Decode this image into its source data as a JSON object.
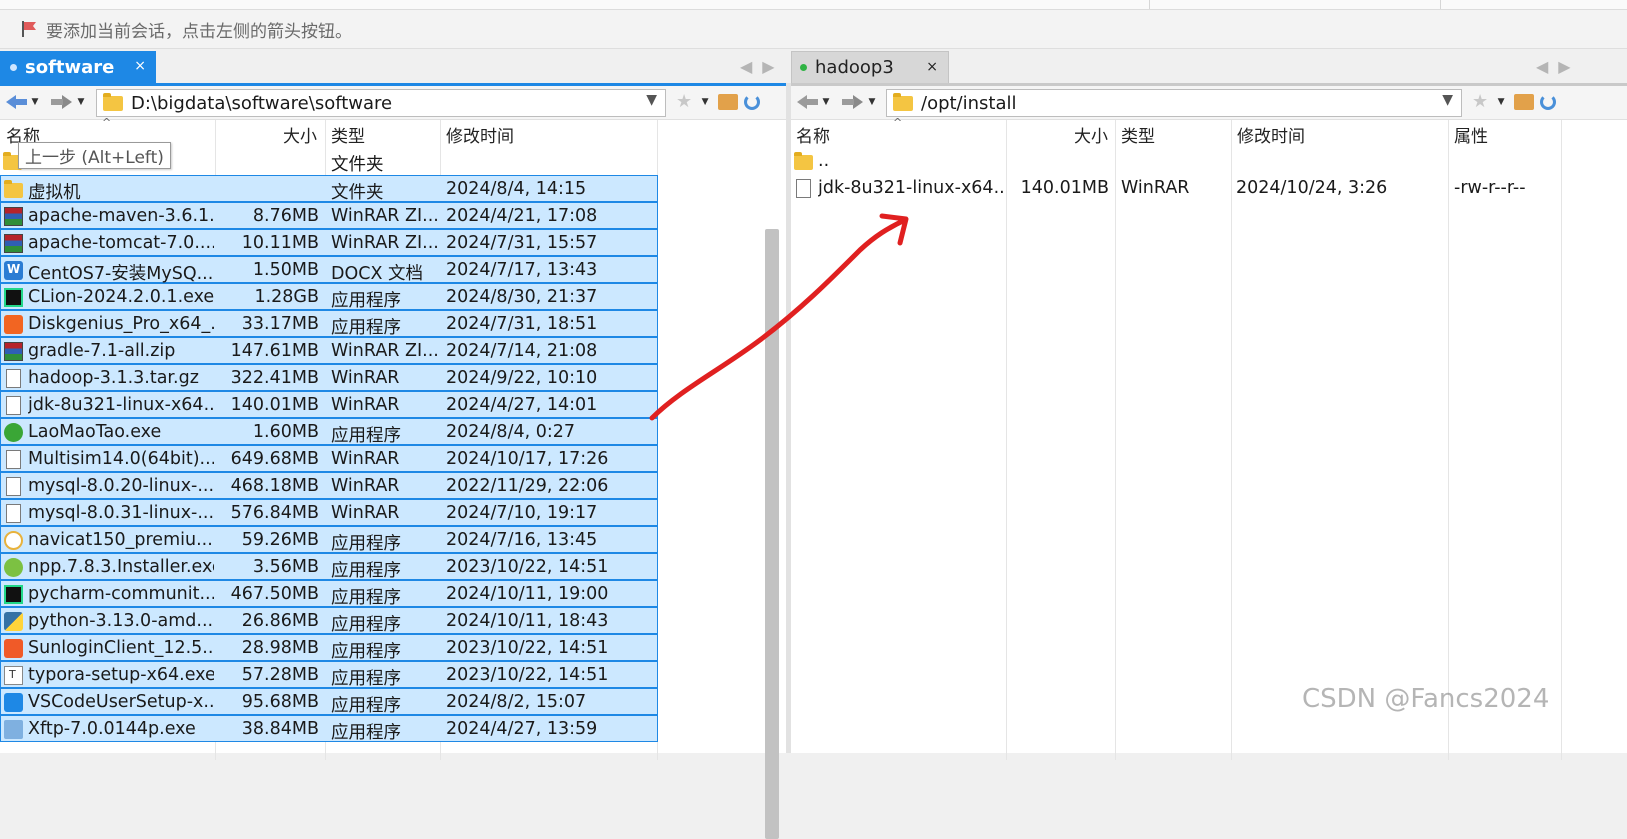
{
  "hint": {
    "text": "要添加当前会话，点击左侧的箭头按钮。"
  },
  "left": {
    "tab": {
      "label": "software",
      "close": "×"
    },
    "path": "D:\\bigdata\\software\\software",
    "columns": {
      "name": "名称",
      "size": "大小",
      "type": "类型",
      "modified": "修改时间"
    },
    "tooltip": "上一步 (Alt+Left)",
    "parent_row": {
      "type": "文件夹"
    },
    "rows": [
      {
        "name": "虚拟机",
        "size": "",
        "type": "文件夹",
        "modified": "2024/8/4, 14:15",
        "icon": "folder"
      },
      {
        "name": "apache-maven-3.6.1...",
        "size": "8.76MB",
        "type": "WinRAR ZI...",
        "modified": "2024/4/21, 17:08",
        "icon": "rar"
      },
      {
        "name": "apache-tomcat-7.0....",
        "size": "10.11MB",
        "type": "WinRAR ZI...",
        "modified": "2024/7/31, 15:57",
        "icon": "rar"
      },
      {
        "name": "CentOS7-安装MySQ...",
        "size": "1.50MB",
        "type": "DOCX 文档",
        "modified": "2024/7/17, 13:43",
        "icon": "word"
      },
      {
        "name": "CLion-2024.2.0.1.exe",
        "size": "1.28GB",
        "type": "应用程序",
        "modified": "2024/8/30, 21:37",
        "icon": "clion"
      },
      {
        "name": "Diskgenius_Pro_x64_...",
        "size": "33.17MB",
        "type": "应用程序",
        "modified": "2024/7/31, 18:51",
        "icon": "dg"
      },
      {
        "name": "gradle-7.1-all.zip",
        "size": "147.61MB",
        "type": "WinRAR ZI...",
        "modified": "2024/7/14, 21:08",
        "icon": "rar"
      },
      {
        "name": "hadoop-3.1.3.tar.gz",
        "size": "322.41MB",
        "type": "WinRAR",
        "modified": "2024/9/22, 10:10",
        "icon": "file"
      },
      {
        "name": "jdk-8u321-linux-x64...",
        "size": "140.01MB",
        "type": "WinRAR",
        "modified": "2024/4/27, 14:01",
        "icon": "file"
      },
      {
        "name": "LaoMaoTao.exe",
        "size": "1.60MB",
        "type": "应用程序",
        "modified": "2024/8/4, 0:27",
        "icon": "lmt"
      },
      {
        "name": "Multisim14.0(64bit)....",
        "size": "649.68MB",
        "type": "WinRAR",
        "modified": "2024/10/17, 17:26",
        "icon": "file"
      },
      {
        "name": "mysql-8.0.20-linux-...",
        "size": "468.18MB",
        "type": "WinRAR",
        "modified": "2022/11/29, 22:06",
        "icon": "file"
      },
      {
        "name": "mysql-8.0.31-linux-...",
        "size": "576.84MB",
        "type": "WinRAR",
        "modified": "2024/7/10, 19:17",
        "icon": "file"
      },
      {
        "name": "navicat150_premiu...",
        "size": "59.26MB",
        "type": "应用程序",
        "modified": "2024/7/16, 13:45",
        "icon": "navicat"
      },
      {
        "name": "npp.7.8.3.Installer.exe",
        "size": "3.56MB",
        "type": "应用程序",
        "modified": "2023/10/22, 14:51",
        "icon": "npp"
      },
      {
        "name": "pycharm-communit...",
        "size": "467.50MB",
        "type": "应用程序",
        "modified": "2024/10/11, 19:00",
        "icon": "pyc"
      },
      {
        "name": "python-3.13.0-amd...",
        "size": "26.86MB",
        "type": "应用程序",
        "modified": "2024/10/11, 18:43",
        "icon": "py"
      },
      {
        "name": "SunloginClient_12.5....",
        "size": "28.98MB",
        "type": "应用程序",
        "modified": "2023/10/22, 14:51",
        "icon": "sun"
      },
      {
        "name": "typora-setup-x64.exe",
        "size": "57.28MB",
        "type": "应用程序",
        "modified": "2023/10/22, 14:51",
        "icon": "typ"
      },
      {
        "name": "VSCodeUserSetup-x...",
        "size": "95.68MB",
        "type": "应用程序",
        "modified": "2024/8/2, 15:07",
        "icon": "vsc"
      },
      {
        "name": "Xftp-7.0.0144p.exe",
        "size": "38.84MB",
        "type": "应用程序",
        "modified": "2024/4/27, 13:59",
        "icon": "xftp"
      }
    ]
  },
  "right": {
    "tab": {
      "label": "hadoop3",
      "close": "×"
    },
    "path": "/opt/install",
    "columns": {
      "name": "名称",
      "size": "大小",
      "type": "类型",
      "modified": "修改时间",
      "attr": "属性"
    },
    "rows": [
      {
        "name": "..",
        "size": "",
        "type": "",
        "modified": "",
        "attr": "",
        "icon": "folder"
      },
      {
        "name": "jdk-8u321-linux-x64...",
        "size": "140.01MB",
        "type": "WinRAR",
        "modified": "2024/10/24, 3:26",
        "attr": "-rw-r--r--",
        "icon": "file"
      }
    ]
  },
  "colors": {
    "accent": "#1e88e5",
    "selection": "#cce8ff",
    "annotation": "#e02020",
    "connected": "#2fb344"
  },
  "watermark": "CSDN @Fancs2024"
}
